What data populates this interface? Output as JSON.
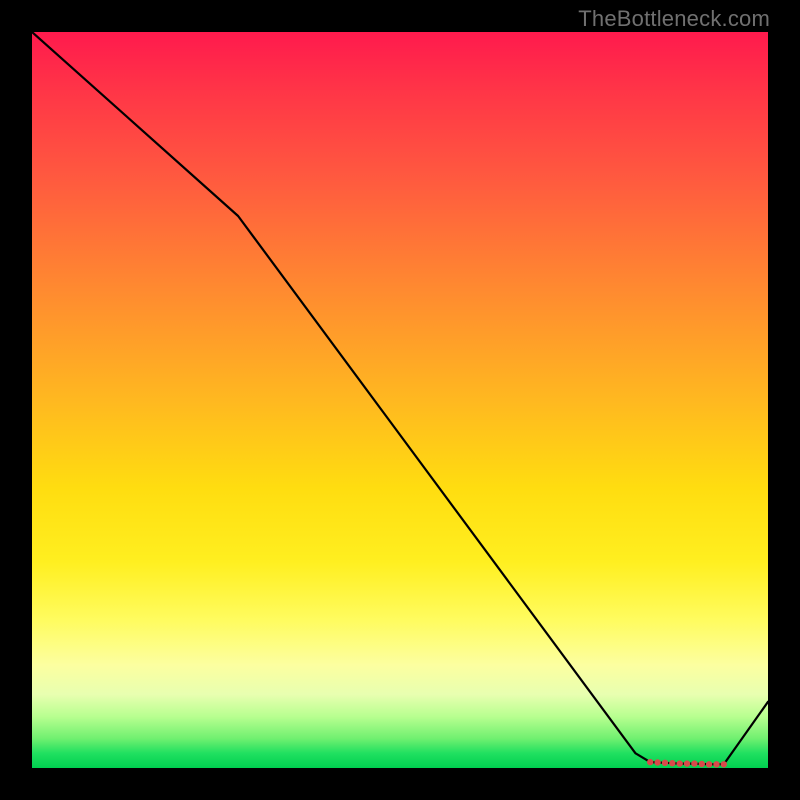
{
  "watermark": "TheBottleneck.com",
  "chart_data": {
    "type": "line",
    "title": "",
    "xlabel": "",
    "ylabel": "",
    "xlim": [
      0,
      100
    ],
    "ylim": [
      0,
      100
    ],
    "grid": false,
    "legend": false,
    "series": [
      {
        "name": "curve",
        "x": [
          0,
          28,
          82,
          84,
          86,
          88,
          90,
          92,
          94,
          100
        ],
        "values": [
          100,
          75,
          2,
          0.8,
          0.7,
          0.6,
          0.6,
          0.5,
          0.5,
          9
        ]
      }
    ],
    "markers": {
      "name": "highlight-points",
      "color": "#d94a4a",
      "x": [
        84,
        85,
        86,
        87,
        88,
        89,
        90,
        91,
        92,
        93,
        94
      ],
      "values": [
        0.8,
        0.75,
        0.7,
        0.65,
        0.6,
        0.6,
        0.6,
        0.55,
        0.5,
        0.5,
        0.5
      ]
    },
    "background": {
      "type": "vertical-heat-gradient",
      "stops": [
        {
          "pos": 0.0,
          "color": "#ff1a4d"
        },
        {
          "pos": 0.35,
          "color": "#ff8a30"
        },
        {
          "pos": 0.62,
          "color": "#ffdd10"
        },
        {
          "pos": 0.86,
          "color": "#fcffa0"
        },
        {
          "pos": 1.0,
          "color": "#00d050"
        }
      ]
    }
  }
}
